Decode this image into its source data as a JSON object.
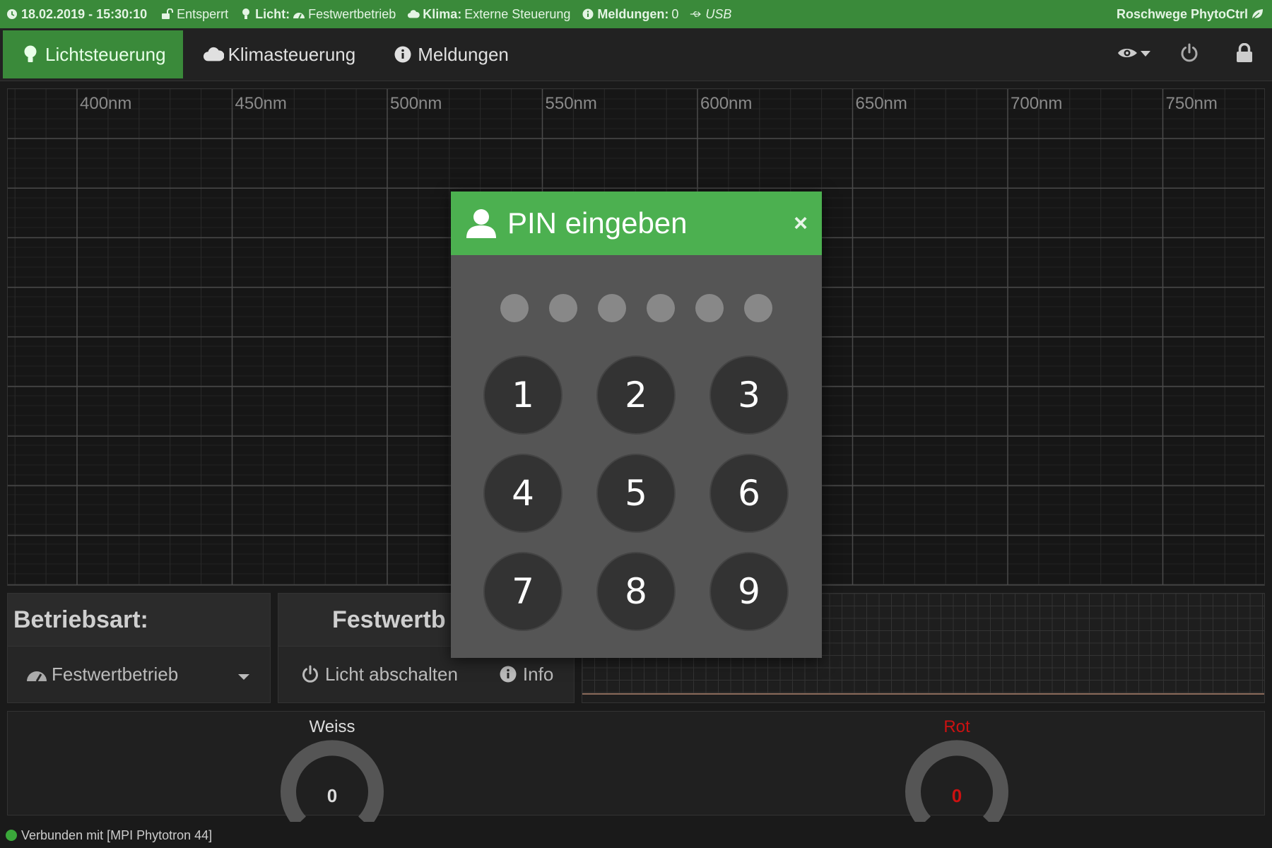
{
  "status": {
    "datetime": "18.02.2019 - 15:30:10",
    "lock_state": "Entsperrt",
    "light_label": "Licht:",
    "light_value": "Festwertbetrieb",
    "climate_label": "Klima:",
    "climate_value": "Externe Steuerung",
    "messages_label": "Meldungen:",
    "messages_value": "0",
    "connection": "USB",
    "brand": "Roschwege PhytoCtrl"
  },
  "nav": {
    "tabs": [
      {
        "label": "Lichtsteuerung",
        "icon": "lightbulb-icon",
        "active": true
      },
      {
        "label": "Klimasteuerung",
        "icon": "cloud-icon",
        "active": false
      },
      {
        "label": "Meldungen",
        "icon": "info-icon",
        "active": false
      }
    ]
  },
  "spectrum": {
    "tick_labels": [
      "400nm",
      "450nm",
      "500nm",
      "550nm",
      "600nm",
      "650nm",
      "700nm",
      "750nm"
    ]
  },
  "mode_panel": {
    "title": "Betriebsart:",
    "selected": "Festwertbetrieb"
  },
  "fixed_panel": {
    "title": "Festwertb",
    "off_button": "Licht abschalten",
    "info_button": "Info"
  },
  "gauges": [
    {
      "label": "Weiss",
      "value": "0",
      "color": "#dddddd"
    },
    {
      "label": "Rot",
      "value": "0",
      "color": "#cc1111"
    }
  ],
  "footer": {
    "status_text": "Verbunden mit [MPI Phytotron 44]"
  },
  "pin_dialog": {
    "title": "PIN eingeben",
    "close_symbol": "×",
    "digits_entered": 0,
    "keys": [
      "1",
      "2",
      "3",
      "4",
      "5",
      "6",
      "7",
      "8",
      "9"
    ]
  },
  "colors": {
    "accent_green": "#3a8a3a",
    "dialog_green": "#4cb050"
  }
}
